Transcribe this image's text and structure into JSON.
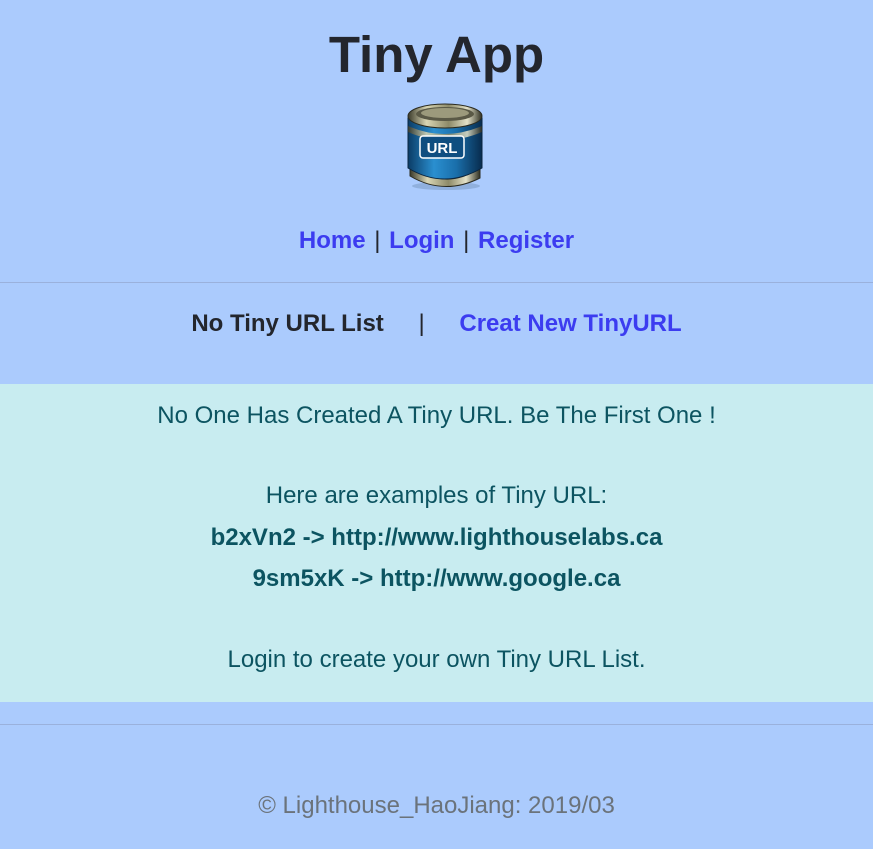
{
  "header": {
    "title": "Tiny App",
    "logo": {
      "icon": "url-can-icon",
      "text": "URL"
    }
  },
  "nav": {
    "home": "Home",
    "login": "Login",
    "register": "Register",
    "separator": "|"
  },
  "subnav": {
    "current": "No Tiny URL List",
    "separator": "|",
    "create": "Creat New TinyURL"
  },
  "panel": {
    "message": "No One Has Created A Tiny URL. Be The First One !",
    "examples_intro": "Here are examples of Tiny URL:",
    "examples": [
      "b2xVn2 -> http://www.lighthouselabs.ca",
      "9sm5xK -> http://www.google.ca"
    ],
    "login_prompt": "Login to create your own Tiny URL List."
  },
  "footer": {
    "copyright": "© Lighthouse_HaoJiang: 2019/03"
  },
  "colors": {
    "background": "#abcbfd",
    "panel": "#c8ecf0",
    "link": "#3c3cf0",
    "panel_text": "#0c5461",
    "footer_text": "#6b737b"
  }
}
